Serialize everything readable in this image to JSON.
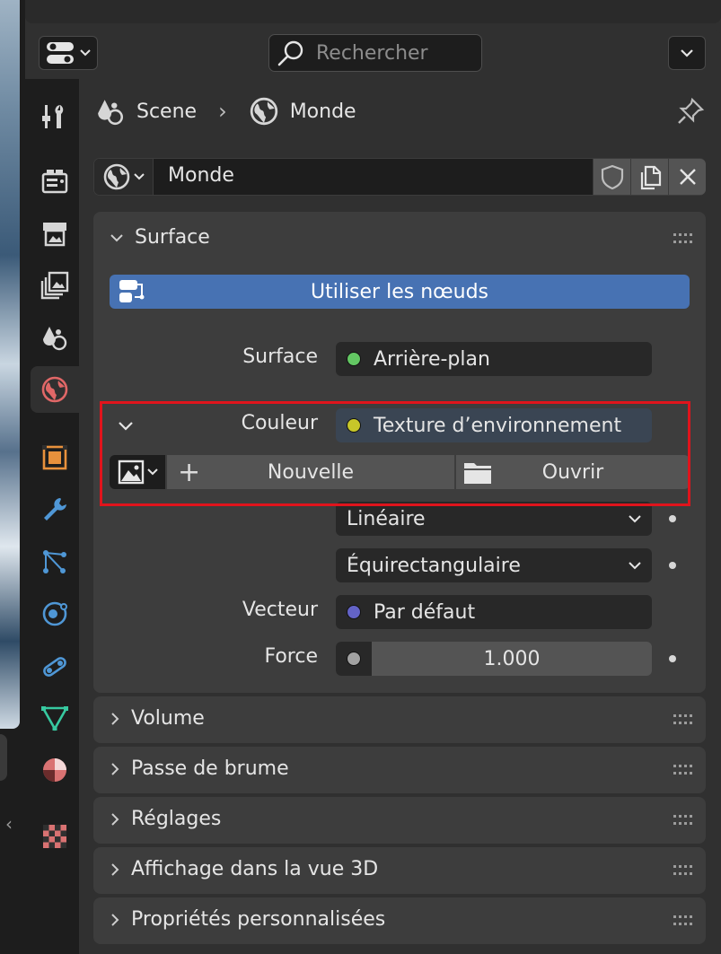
{
  "header": {
    "search_placeholder": "Rechercher"
  },
  "tabs": [
    {
      "name": "tool-tab",
      "icon": "tool-icon"
    },
    {
      "name": "render-tab",
      "icon": "render-icon"
    },
    {
      "name": "output-tab",
      "icon": "output-icon"
    },
    {
      "name": "view-layer-tab",
      "icon": "view-layer-icon"
    },
    {
      "name": "scene-tab",
      "icon": "scene-icon"
    },
    {
      "name": "world-tab",
      "icon": "world-icon",
      "active": true
    },
    {
      "name": "object-tab",
      "icon": "object-icon"
    },
    {
      "name": "modifier-tab",
      "icon": "wrench-icon"
    },
    {
      "name": "particles-tab",
      "icon": "particles-icon"
    },
    {
      "name": "physics-tab",
      "icon": "physics-icon"
    },
    {
      "name": "constraints-tab",
      "icon": "constraints-icon"
    },
    {
      "name": "data-tab",
      "icon": "mesh-data-icon"
    },
    {
      "name": "material-tab",
      "icon": "material-icon"
    },
    {
      "name": "texture-tab",
      "icon": "texture-icon"
    }
  ],
  "breadcrumb": {
    "scene": "Scene",
    "world": "Monde"
  },
  "world_selector": {
    "name": "Monde"
  },
  "surface_panel": {
    "title": "Surface",
    "use_nodes": "Utiliser les nœuds",
    "surface_label": "Surface",
    "surface_value": "Arrière-plan",
    "color_label": "Couleur",
    "color_value": "Texture d’environnement",
    "new_button": "Nouvelle",
    "open_button": "Ouvrir",
    "interpolation": "Linéaire",
    "projection": "Équirectangulaire",
    "vector_label": "Vecteur",
    "vector_value": "Par défaut",
    "force_label": "Force",
    "force_value": "1.000"
  },
  "panels": [
    {
      "title": "Volume"
    },
    {
      "title": "Passe de brume"
    },
    {
      "title": "Réglages"
    },
    {
      "title": "Affichage dans la vue 3D"
    },
    {
      "title": "Propriétés personnalisées"
    }
  ],
  "colors": {
    "accent_blue": "#4772b3",
    "socket_green": "#63c763",
    "socket_yellow": "#c7c729",
    "socket_purple": "#6363c7",
    "socket_grey": "#a1a1a1",
    "highlight_red": "#e0141c"
  }
}
